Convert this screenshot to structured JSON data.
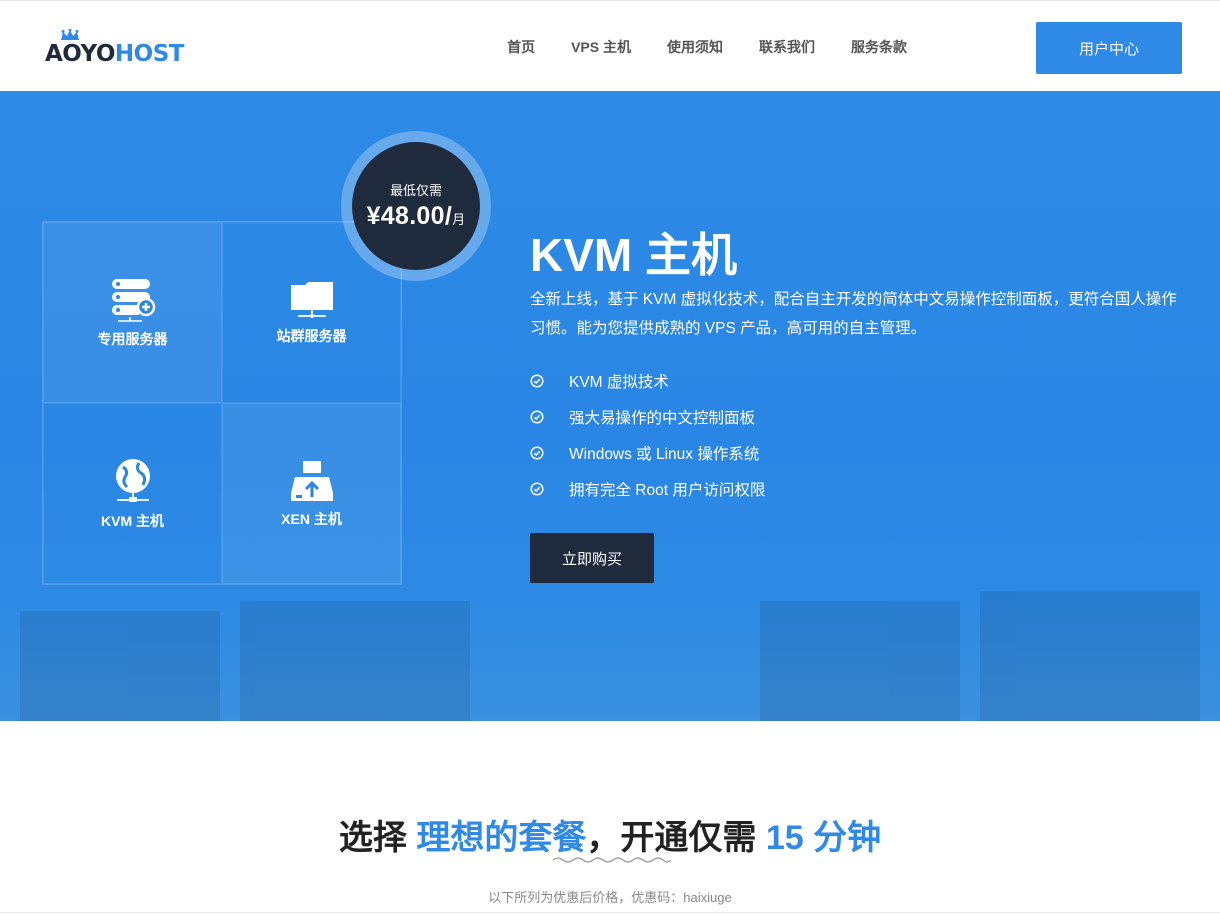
{
  "brand": {
    "part1": "AOYO",
    "part2": "HOST"
  },
  "nav": {
    "items": [
      {
        "label": "首页"
      },
      {
        "label": "VPS 主机"
      },
      {
        "label": "使用须知"
      },
      {
        "label": "联系我们"
      },
      {
        "label": "服务条款"
      }
    ],
    "user_center": "用户中心"
  },
  "hero": {
    "badge": {
      "label": "最低仅需",
      "price": "¥48.00/",
      "unit": "月"
    },
    "cells": [
      {
        "label": "专用服务器",
        "icon": "server-add-icon"
      },
      {
        "label": "站群服务器",
        "icon": "folder-network-icon"
      },
      {
        "label": "KVM 主机",
        "icon": "globe-network-icon"
      },
      {
        "label": "XEN 主机",
        "icon": "drive-upload-icon"
      }
    ],
    "title": "KVM 主机",
    "description": "全新上线，基于 KVM 虚拟化技术，配合自主开发的简体中文易操作控制面板，更符合国人操作习惯。能为您提供成熟的 VPS 产品，高可用的自主管理。",
    "features": [
      "KVM 虚拟技术",
      "强大易操作的中文控制面板",
      "Windows 或 Linux 操作系统",
      "拥有完全 Root 用户访问权限"
    ],
    "buy_label": "立即购买"
  },
  "section": {
    "title_part1": "选择 ",
    "title_part2": "理想的套餐",
    "title_part3": "，开通仅需 ",
    "title_part4": "15 分钟",
    "subtitle": "以下所列为优惠后价格，优惠码：haixiuge"
  },
  "colors": {
    "accent": "#2e8ae6",
    "dark": "#1f2a3c"
  }
}
